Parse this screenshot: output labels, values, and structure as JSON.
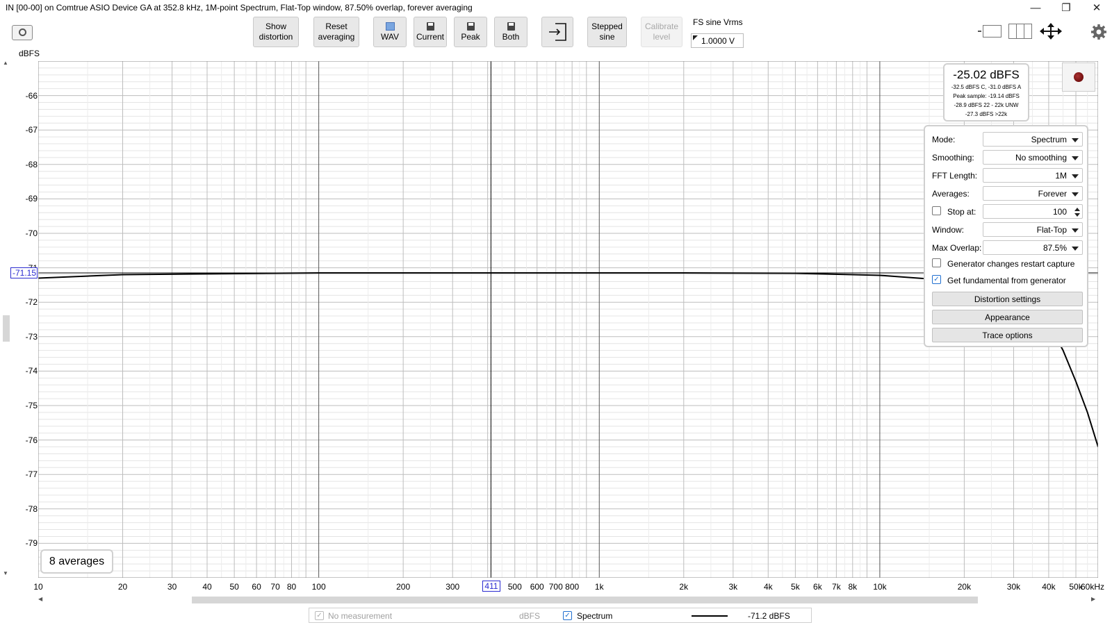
{
  "window": {
    "title": "IN [00-00] on Comtrue ASIO Device GA at 352.8 kHz, 1M-point Spectrum, Flat-Top window, 87.50% overlap, forever averaging",
    "minimize": "—",
    "maximize": "❐",
    "close": "✕"
  },
  "toolbar": {
    "show_distortion_1": "Show",
    "show_distortion_2": "distortion",
    "reset_1": "Reset",
    "reset_2": "averaging",
    "wav": "WAV",
    "current": "Current",
    "peak": "Peak",
    "both": "Both",
    "stepped_1": "Stepped",
    "stepped_2": "sine",
    "calibrate_1": "Calibrate",
    "calibrate_2": "level",
    "fs_label": "FS sine Vrms",
    "fs_value": "1.0000 V"
  },
  "axis": {
    "y_unit": "dBFS",
    "y_ticks": [
      "-66",
      "-67",
      "-68",
      "-69",
      "-70",
      "-71",
      "-72",
      "-73",
      "-74",
      "-75",
      "-76",
      "-77",
      "-78",
      "-79"
    ],
    "x_ticks": [
      "10",
      "20",
      "30",
      "40",
      "50",
      "60",
      "70",
      "80",
      "100",
      "200",
      "300",
      "500",
      "600",
      "700",
      "800",
      "1k",
      "2k",
      "3k",
      "4k",
      "5k",
      "6k",
      "7k",
      "8k",
      "10k",
      "20k",
      "30k",
      "40k",
      "50k",
      "60kHz"
    ]
  },
  "cursor": {
    "x_label": "411",
    "y_label": "-71.15"
  },
  "level": {
    "main": "-25.02 dBFS",
    "line1": "-32.5 dBFS C, -31.0 dBFS A",
    "line2": "Peak sample: -19.14 dBFS",
    "line3": "-28.9 dBFS 22 - 22k UNW",
    "line4": "-27.3 dBFS >22k"
  },
  "settings": {
    "mode_label": "Mode:",
    "mode_value": "Spectrum",
    "smoothing_label": "Smoothing:",
    "smoothing_value": "No smoothing",
    "fft_label": "FFT Length:",
    "fft_value": "1M",
    "averages_label": "Averages:",
    "averages_value": "Forever",
    "stop_label": "Stop at:",
    "stop_value": "100",
    "window_label": "Window:",
    "window_value": "Flat-Top",
    "overlap_label": "Max Overlap:",
    "overlap_value": "87.5%",
    "gen_restart_label": "Generator changes restart capture",
    "gen_fund_label": "Get fundamental from generator",
    "distortion_btn": "Distortion settings",
    "appearance_btn": "Appearance",
    "trace_btn": "Trace options"
  },
  "averages_badge": "8 averages",
  "legend": {
    "no_measurement": "No measurement",
    "unit": "dBFS",
    "spectrum": "Spectrum",
    "spectrum_value": "-71.2 dBFS"
  },
  "icons": {
    "camera": "camera-icon",
    "record": "record-icon",
    "gear": "gear-icon",
    "move": "move-icon",
    "import": "import-icon"
  },
  "colors": {
    "cursor": "#2a2ad0",
    "trace": "#000000",
    "check": "#1f6fd0",
    "record": "#7a0000"
  },
  "chart_data": {
    "type": "line",
    "xscale": "log",
    "xlim": [
      10,
      60000
    ],
    "ylim": [
      -80,
      -65
    ],
    "grid": true,
    "series": [
      {
        "name": "Spectrum",
        "x": [
          10,
          20,
          50,
          100,
          200,
          411,
          1000,
          2000,
          5000,
          8000,
          10000,
          20000,
          30000,
          38000,
          45000,
          50000,
          55000,
          60000
        ],
        "y": [
          -71.3,
          -71.2,
          -71.17,
          -71.15,
          -71.15,
          -71.15,
          -71.15,
          -71.15,
          -71.16,
          -71.2,
          -71.22,
          -71.4,
          -71.7,
          -72.3,
          -73.4,
          -74.3,
          -75.2,
          -76.2
        ]
      }
    ]
  }
}
